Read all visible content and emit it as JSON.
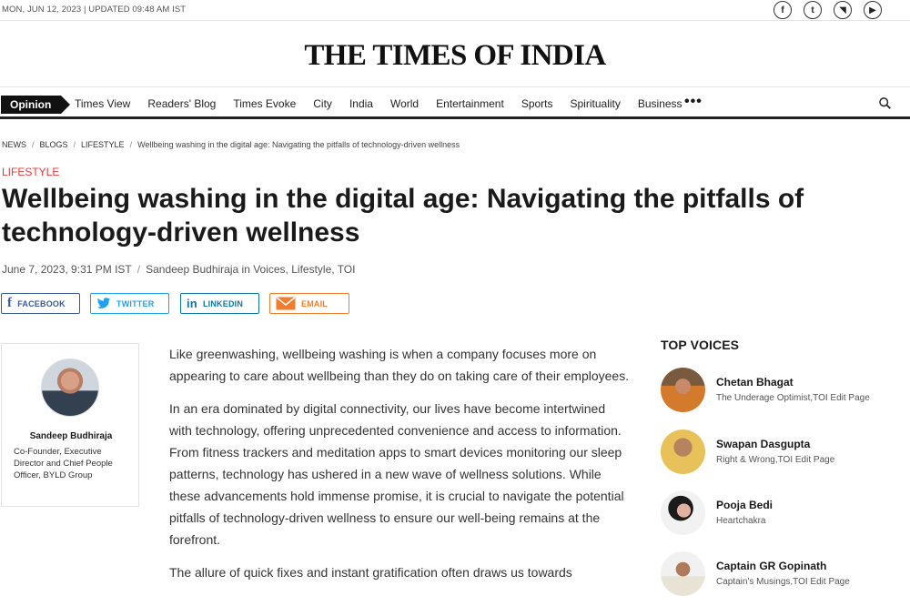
{
  "topbar": {
    "date": "MON, JUN 12, 2023 | UPDATED 09:48 AM IST",
    "social": [
      {
        "icon": "facebook-icon",
        "glyph": "f"
      },
      {
        "icon": "twitter-icon",
        "glyph": "t"
      },
      {
        "icon": "rss-icon",
        "glyph": "◥"
      },
      {
        "icon": "youtube-icon",
        "glyph": "▶"
      }
    ]
  },
  "masthead": {
    "logo": "THE TIMES OF INDIA"
  },
  "nav": {
    "active": "Opinion",
    "items": [
      "Times View",
      "Readers' Blog",
      "Times Evoke",
      "City",
      "India",
      "World",
      "Entertainment",
      "Sports",
      "Spirituality",
      "Business"
    ],
    "more": "•••"
  },
  "breadcrumb": {
    "items": [
      "NEWS",
      "BLOGS",
      "LIFESTYLE"
    ],
    "current": "Wellbeing washing in the digital age: Navigating the pitfalls of technology-driven wellness"
  },
  "article": {
    "section": "LIFESTYLE",
    "headline": "Wellbeing washing in the digital age: Navigating the pitfalls of technology-driven wellness",
    "date": "June 7, 2023, 9:31 PM IST",
    "byline": "Sandeep Budhiraja in Voices, Lifestyle, TOI",
    "paragraphs": [
      "Like greenwashing, wellbeing washing is when a company focuses more on appearing to care about wellbeing than they do on taking care of their employees.",
      "In an era dominated by digital connectivity, our lives have become intertwined with technology, offering unprecedented convenience and access to information. From fitness trackers and meditation apps to smart devices monitoring our sleep patterns, technology has ushered in a new wave of wellness solutions. While these advancements hold immense promise, it is crucial to navigate the potential pitfalls of technology-driven wellness to ensure our well-being remains at the forefront.",
      "The allure of quick fixes and instant gratification often draws us towards"
    ]
  },
  "share": {
    "facebook": "FACEBOOK",
    "twitter": "TWITTER",
    "linkedin": "LINKEDIN",
    "email": "EMAIL"
  },
  "author": {
    "name": "Sandeep Budhiraja",
    "role": "Co-Founder, Executive Director and Chief People Officer, BYLD Group"
  },
  "top_voices": {
    "title": "TOP VOICES",
    "items": [
      {
        "name": "Chetan Bhagat",
        "desc": "The Underage Optimist,TOI Edit Page"
      },
      {
        "name": "Swapan Dasgupta",
        "desc": "Right & Wrong,TOI Edit Page"
      },
      {
        "name": "Pooja Bedi",
        "desc": "Heartchakra"
      },
      {
        "name": "Captain GR Gopinath",
        "desc": "Captain's Musings,TOI Edit Page"
      }
    ]
  },
  "colors": {
    "section_red": "#e03b3b",
    "facebook": "#3b5998",
    "twitter": "#1da1f2",
    "linkedin": "#0e76a8",
    "email": "#f07c2c"
  }
}
